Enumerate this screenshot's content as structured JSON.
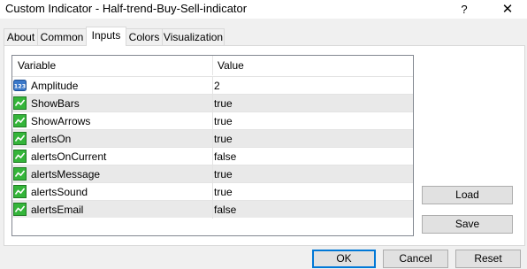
{
  "window": {
    "title": "Custom Indicator - Half-trend-Buy-Sell-indicator",
    "help_label": "?",
    "close_label": "✕"
  },
  "tabs": [
    {
      "label": "About"
    },
    {
      "label": "Common"
    },
    {
      "label": "Inputs",
      "active": true
    },
    {
      "label": "Colors"
    },
    {
      "label": "Visualization"
    }
  ],
  "grid": {
    "headers": {
      "variable": "Variable",
      "value": "Value"
    },
    "rows": [
      {
        "variable": "Amplitude",
        "value": "2",
        "icon": "integer-icon"
      },
      {
        "variable": "ShowBars",
        "value": "true",
        "icon": "boolean-icon"
      },
      {
        "variable": "ShowArrows",
        "value": "true",
        "icon": "boolean-icon"
      },
      {
        "variable": "alertsOn",
        "value": "true",
        "icon": "boolean-icon"
      },
      {
        "variable": "alertsOnCurrent",
        "value": "false",
        "icon": "boolean-icon"
      },
      {
        "variable": "alertsMessage",
        "value": "true",
        "icon": "boolean-icon"
      },
      {
        "variable": "alertsSound",
        "value": "true",
        "icon": "boolean-icon"
      },
      {
        "variable": "alertsEmail",
        "value": "false",
        "icon": "boolean-icon"
      }
    ]
  },
  "side_buttons": {
    "load": "Load",
    "save": "Save"
  },
  "footer_buttons": {
    "ok": "OK",
    "cancel": "Cancel",
    "reset": "Reset"
  },
  "colors": {
    "accent": "#0078d7",
    "alt_row": "#e9e9e9",
    "button_face": "#e1e1e1"
  }
}
